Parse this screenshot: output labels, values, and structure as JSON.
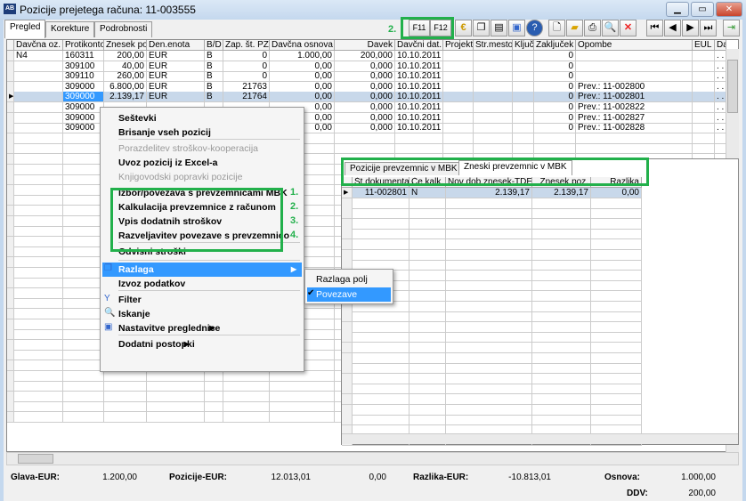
{
  "window": {
    "title": "Pozicije prejetega računa: 11-003555",
    "icon_text": "AB"
  },
  "tabs": [
    {
      "label": "Pregled"
    },
    {
      "label": "Korekture"
    },
    {
      "label": "Podrobnosti"
    }
  ],
  "toolbar": {
    "annotation": "2.",
    "f11": "F11",
    "f12": "F12"
  },
  "grid": {
    "columns": [
      "Davčna oz.",
      "Protikonto",
      "Znesek poz.",
      "Den.enota",
      "B/D",
      "Zap. št. PZ",
      "Davčna osnova",
      "Davek",
      "Davčni dat.",
      "Projekt",
      "Str.mesto",
      "Ključ",
      "Zaključek",
      "Opombe",
      "EUL",
      "Dal"
    ],
    "rows": [
      [
        "N4",
        "160311",
        "200,00",
        "EUR",
        "B",
        "0",
        "1.000,00",
        "200,000",
        "10.10.2011",
        "",
        "",
        "",
        "0",
        "",
        "",
        " . ."
      ],
      [
        "",
        "309100",
        "40,00",
        "EUR",
        "B",
        "0",
        "0,00",
        "0,000",
        "10.10.2011",
        "",
        "",
        "",
        "0",
        "",
        "",
        " . ."
      ],
      [
        "",
        "309110",
        "260,00",
        "EUR",
        "B",
        "0",
        "0,00",
        "0,000",
        "10.10.2011",
        "",
        "",
        "",
        "0",
        "",
        "",
        " . ."
      ],
      [
        "",
        "309000",
        "6.800,00",
        "EUR",
        "B",
        "21763",
        "0,00",
        "0,000",
        "10.10.2011",
        "",
        "",
        "",
        "0",
        "Prev.: 11-002800",
        "",
        " . ."
      ],
      [
        "",
        "309000",
        "2.139,17",
        "EUR",
        "B",
        "21764",
        "0,00",
        "0,000",
        "10.10.2011",
        "",
        "",
        "",
        "0",
        "Prev.: 11-002801",
        "",
        " . ."
      ],
      [
        "",
        "309000",
        "",
        "",
        "",
        "",
        "0,00",
        "0,000",
        "10.10.2011",
        "",
        "",
        "",
        "0",
        "Prev.: 11-002822",
        "",
        " . ."
      ],
      [
        "",
        "309000",
        "",
        "",
        "",
        "",
        "0,00",
        "0,000",
        "10.10.2011",
        "",
        "",
        "",
        "0",
        "Prev.: 11-002827",
        "",
        " . ."
      ],
      [
        "",
        "309000",
        "",
        "",
        "",
        "",
        "0,00",
        "0,000",
        "10.10.2011",
        "",
        "",
        "",
        "0",
        "Prev.: 11-002828",
        "",
        " . ."
      ]
    ],
    "selected_row": 4
  },
  "context_menu": {
    "items": [
      {
        "label": "Seštevki",
        "disabled": false
      },
      {
        "label": "Brisanje vseh pozicij",
        "disabled": false
      },
      {
        "label": "Porazdelitev stroškov-kooperacija",
        "disabled": true
      },
      {
        "label": "Uvoz pozicij iz Excel-a",
        "disabled": false
      },
      {
        "label": "Knjigovodski popravki pozicije",
        "disabled": true
      },
      {
        "label": "Izbor/povezava s prevzemnicami MBK",
        "disabled": false,
        "num": "1."
      },
      {
        "label": "Kalkulacija prevzemnice z računom",
        "disabled": false,
        "num": "2."
      },
      {
        "label": "Vpis dodatnih stroškov",
        "disabled": false,
        "num": "3."
      },
      {
        "label": "Razveljavitev povezave s prevzemnico",
        "disabled": false,
        "num": "4."
      },
      {
        "label": "Odvisni stroški",
        "disabled": false
      },
      {
        "label": "Razlaga",
        "disabled": false
      },
      {
        "label": "Izvoz podatkov",
        "disabled": false
      },
      {
        "label": "Filter",
        "disabled": false
      },
      {
        "label": "Iskanje",
        "disabled": false
      },
      {
        "label": "Nastavitve preglednice",
        "disabled": false
      },
      {
        "label": "Dodatni postopki",
        "disabled": false
      }
    ],
    "submenu": [
      {
        "label": "Razlaga polj",
        "checked": false
      },
      {
        "label": "Povezave",
        "checked": true
      }
    ]
  },
  "panel": {
    "tabs": [
      "Pozicije prevzemnic v MBK",
      "Zneski prevzemnic v MBK"
    ],
    "active_tab": 1,
    "columns": [
      "Št.dokumenta",
      "Če kalk.",
      "Nov dob.znesek-TDE",
      "Znesek poz.",
      "Razlika"
    ],
    "rows": [
      [
        "11-002801",
        "N",
        "2.139,17",
        "2.139,17",
        "0,00"
      ]
    ]
  },
  "footer": {
    "glava_label": "Glava-EUR:",
    "glava_value": "1.200,00",
    "pozicije_label": "Pozicije-EUR:",
    "pozicije_value": "12.013,01",
    "extra_value": "0,00",
    "razlika_label": "Razlika-EUR:",
    "razlika_value": "-10.813,01",
    "osnova_label": "Osnova:",
    "osnova_value": "1.000,00",
    "ddv_label": "DDV:",
    "ddv_value": "200,00"
  },
  "colors": {
    "highlight": "#22b04b",
    "selection": "#3399ff"
  }
}
